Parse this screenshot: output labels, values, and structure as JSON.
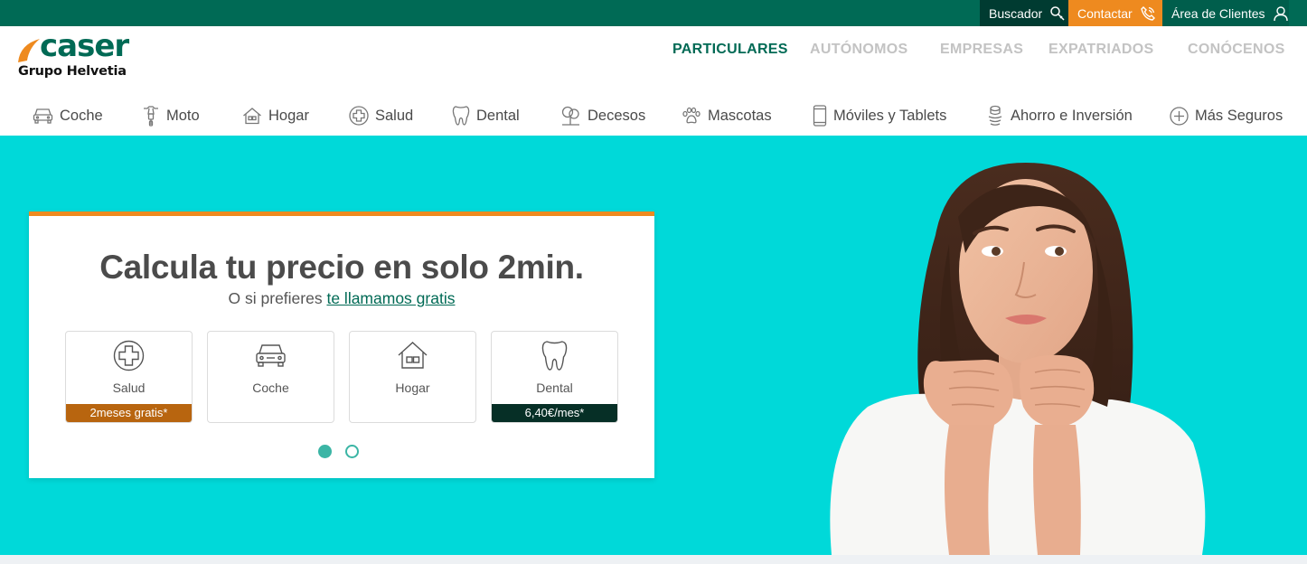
{
  "topbar": {
    "search_label": "Buscador",
    "contact_label": "Contactar",
    "clients_label": "Área de Clientes",
    "search_icon": "search-icon",
    "contact_icon": "phone-icon",
    "clients_icon": "user-icon"
  },
  "logo": {
    "word": "caser",
    "subtitle": "Grupo Helvetia"
  },
  "main_nav": {
    "particulares": "PARTICULARES",
    "autonomos": "AUTÓNOMOS",
    "empresas": "EMPRESAS",
    "expatriados": "EXPATRIADOS",
    "conocenos": "CONÓCENOS",
    "active": "PARTICULARES"
  },
  "sub_nav": {
    "coche": "Coche",
    "moto": "Moto",
    "hogar": "Hogar",
    "salud": "Salud",
    "dental": "Dental",
    "decesos": "Decesos",
    "mascotas": "Mascotas",
    "moviles": "Móviles y Tablets",
    "ahorro": "Ahorro e Inversión",
    "mas": "Más Seguros"
  },
  "hero": {
    "title": "Calcula tu precio en solo 2min.",
    "subtitle_prefix": "O si prefieres ",
    "subtitle_link": "te llamamos gratis",
    "products": {
      "salud": {
        "label": "Salud",
        "badge": "2meses gratis*"
      },
      "coche": {
        "label": "Coche"
      },
      "hogar": {
        "label": "Hogar"
      },
      "dental": {
        "label": "Dental",
        "badge": "6,40€/mes*"
      }
    },
    "carousel_pages": 2,
    "carousel_active": 1
  },
  "colors": {
    "brand_green": "#006a55",
    "dark_green": "#003b31",
    "accent_orange": "#ee8a1f",
    "hero_cyan": "#00d9d9",
    "salud_badge": "#b8650f",
    "dental_badge": "#062f26",
    "dot": "#3bb5a5"
  }
}
